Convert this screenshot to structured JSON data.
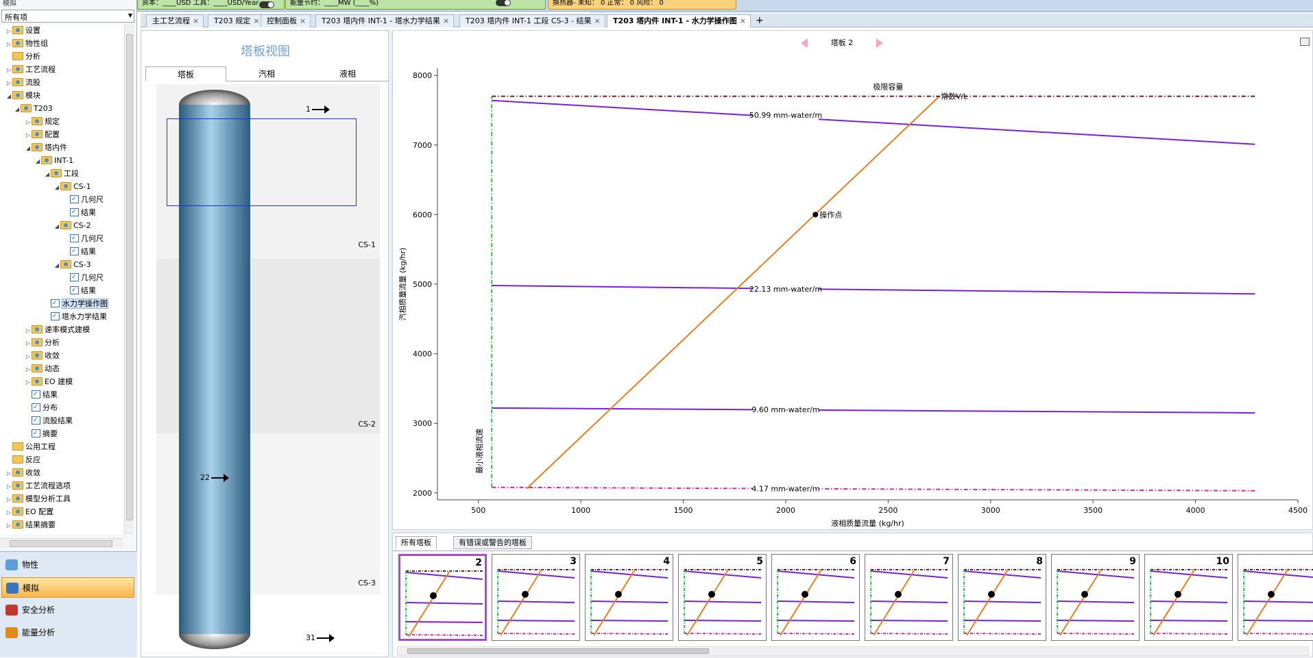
{
  "topbar": {
    "tree_header": "模拟",
    "capital_text": "资本：____USD  工具：____USD/Year",
    "energy_text": "能量节约：____MW  (____%)",
    "hx_text": "换热器- 未知： 0  正常： 0  风险： 0"
  },
  "tree": {
    "filter": "所有项",
    "nodes": [
      {
        "label": "设置",
        "exp": "▷",
        "icon": "folder-gear-icon"
      },
      {
        "label": "物性组",
        "exp": "▷",
        "icon": "folder-gear-icon"
      },
      {
        "label": "分析",
        "exp": "",
        "icon": "folder-icon"
      },
      {
        "label": "工艺流程",
        "exp": "▷",
        "icon": "folder-gear-icon"
      },
      {
        "label": "流股",
        "exp": "▷",
        "icon": "folder-gear-icon"
      },
      {
        "label": "模块",
        "exp": "◢",
        "icon": "folder-gear-icon"
      },
      {
        "label": "T203",
        "exp": "◢",
        "icon": "folder-gear-icon"
      },
      {
        "label": "规定",
        "exp": "▷",
        "icon": "folder-gear-icon"
      },
      {
        "label": "配置",
        "exp": "▷",
        "icon": "folder-gear-icon"
      },
      {
        "label": "塔内件",
        "exp": "◢",
        "icon": "folder-gear-icon"
      },
      {
        "label": "INT-1",
        "exp": "◢",
        "icon": "folder-gear-icon"
      },
      {
        "label": "工段",
        "exp": "◢",
        "icon": "folder-gear-icon"
      },
      {
        "label": "CS-1",
        "exp": "◢",
        "icon": "folder-gear-icon"
      },
      {
        "label": "几何尺",
        "exp": "",
        "icon": "doc-check-icon"
      },
      {
        "label": "结果",
        "exp": "",
        "icon": "doc-check-icon"
      },
      {
        "label": "CS-2",
        "exp": "◢",
        "icon": "folder-gear-icon"
      },
      {
        "label": "几何尺",
        "exp": "",
        "icon": "doc-check-icon"
      },
      {
        "label": "结果",
        "exp": "",
        "icon": "doc-check-icon"
      },
      {
        "label": "CS-3",
        "exp": "◢",
        "icon": "folder-gear-icon"
      },
      {
        "label": "几何尺",
        "exp": "",
        "icon": "doc-check-icon"
      },
      {
        "label": "结果",
        "exp": "",
        "icon": "doc-check-icon"
      },
      {
        "label": "水力学操作图",
        "exp": "",
        "icon": "doc-check-icon",
        "selected": true
      },
      {
        "label": "塔水力学结果",
        "exp": "",
        "icon": "doc-check-icon"
      },
      {
        "label": "速率模式建模",
        "exp": "▷",
        "icon": "folder-gear-icon"
      },
      {
        "label": "分析",
        "exp": "▷",
        "icon": "folder-gear-icon"
      },
      {
        "label": "收敛",
        "exp": "▷",
        "icon": "folder-gear-icon"
      },
      {
        "label": "动态",
        "exp": "▷",
        "icon": "folder-gear-icon"
      },
      {
        "label": "EO 建模",
        "exp": "▷",
        "icon": "folder-gear-icon"
      },
      {
        "label": "结果",
        "exp": "",
        "icon": "doc-check-icon"
      },
      {
        "label": "分布",
        "exp": "",
        "icon": "doc-check-icon"
      },
      {
        "label": "流股结果",
        "exp": "",
        "icon": "doc-check-icon"
      },
      {
        "label": "摘要",
        "exp": "",
        "icon": "doc-check-icon"
      },
      {
        "label": "公用工程",
        "exp": "",
        "icon": "folder-icon"
      },
      {
        "label": "反应",
        "exp": "",
        "icon": "folder-icon"
      },
      {
        "label": "收敛",
        "exp": "▷",
        "icon": "folder-gear-icon"
      },
      {
        "label": "工艺流程选项",
        "exp": "▷",
        "icon": "folder-gear-icon"
      },
      {
        "label": "模型分析工具",
        "exp": "▷",
        "icon": "folder-gear-icon"
      },
      {
        "label": "EO 配置",
        "exp": "▷",
        "icon": "folder-gear-icon"
      },
      {
        "label": "结果摘要",
        "exp": "▷",
        "icon": "folder-gear-icon"
      }
    ]
  },
  "nav": {
    "items": [
      {
        "label": "物性",
        "icon": "flask-icon"
      },
      {
        "label": "模拟",
        "icon": "flowsheet-icon",
        "active": true
      },
      {
        "label": "安全分析",
        "icon": "safety-icon"
      },
      {
        "label": "能量分析",
        "icon": "energy-icon"
      }
    ]
  },
  "tabs": [
    {
      "label": "主工艺流程"
    },
    {
      "label": "T203 规定"
    },
    {
      "label": "控制面板"
    },
    {
      "label": "T203 塔内件 INT-1 - 塔水力学结果"
    },
    {
      "label": "T203 塔内件 INT-1 工段 CS-3 - 结果"
    },
    {
      "label": "T203 塔内件 INT-1 - 水力学操作图",
      "active": true
    }
  ],
  "tray_view": {
    "title": "塔板视图",
    "tabs": [
      "塔板",
      "汽相",
      "液相"
    ],
    "sections": [
      "CS-1",
      "CS-2",
      "CS-3"
    ],
    "streams": {
      "top": "1",
      "feed": "22",
      "bottom": "31"
    }
  },
  "chart_header": {
    "label": "塔板 2"
  },
  "chart_data": {
    "type": "line",
    "title": "极限容量",
    "xlabel": "液相质量流量 (kg/hr)",
    "ylabel": "汽相质量流量 (kg/hr)",
    "xlim": [
      300,
      4500
    ],
    "ylim": [
      1900,
      8100
    ],
    "xticks": [
      500,
      1000,
      1500,
      2000,
      2500,
      3000,
      3500,
      4000,
      4500
    ],
    "yticks": [
      2000,
      3000,
      4000,
      5000,
      6000,
      7000,
      8000
    ],
    "grid": false,
    "series": [
      {
        "name": "50.99 mm-water/m",
        "color": "#7a1fd9",
        "style": "solid",
        "x": [
          565,
          4290
        ],
        "y": [
          7640,
          7010
        ],
        "label_at": [
          2000,
          7420
        ]
      },
      {
        "name": "22.13 mm-water/m",
        "color": "#7a1fd9",
        "style": "solid",
        "x": [
          565,
          4290
        ],
        "y": [
          4980,
          4860
        ],
        "label_at": [
          2000,
          4920
        ]
      },
      {
        "name": "9.60 mm-water/m",
        "color": "#7a1fd9",
        "style": "solid",
        "x": [
          565,
          4290
        ],
        "y": [
          3220,
          3150
        ],
        "label_at": [
          2000,
          3190
        ]
      },
      {
        "name": "4.17 mm-water/m",
        "color": "#e020a0",
        "style": "dashdot",
        "x": [
          565,
          4290
        ],
        "y": [
          2080,
          2030
        ],
        "label_at": [
          2000,
          2055
        ]
      },
      {
        "name": "常数V/L",
        "color": "#f07b1a",
        "style": "solid",
        "x": [
          735,
          2750
        ],
        "y": [
          2060,
          7700
        ]
      },
      {
        "name": "",
        "color": "#6b1a1a",
        "style": "dashdot",
        "x": [
          565,
          4290
        ],
        "y": [
          7700,
          7700
        ]
      },
      {
        "name": "最小液相流速",
        "color": "#22cc44",
        "style": "dashdot",
        "x": [
          565,
          565
        ],
        "y": [
          2080,
          7700
        ]
      }
    ],
    "operating_point": {
      "label": "操作点",
      "x": 2145,
      "y": 6000
    }
  },
  "thumbs": {
    "tabs": [
      "所有塔板",
      "有错误或警告的塔板"
    ],
    "numbers": [
      "2",
      "3",
      "4",
      "5",
      "6",
      "7",
      "8",
      "9",
      "10",
      ""
    ]
  }
}
